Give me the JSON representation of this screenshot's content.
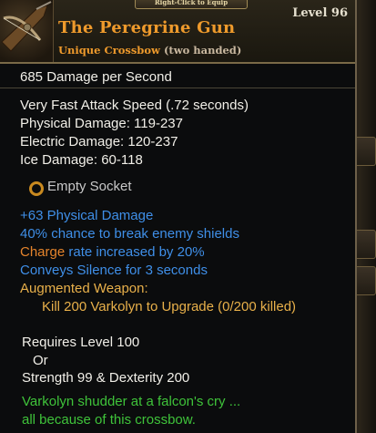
{
  "header": {
    "tab_label": "Right-Click to Equip",
    "item_name": "The Peregrine Gun",
    "item_type": "Unique Crossbow",
    "item_hands": "(two handed)",
    "level": "Level 96",
    "icon": "crossbow-icon"
  },
  "dps": {
    "value": "685",
    "label": "Damage per Second"
  },
  "base_stats": [
    "Very Fast Attack Speed (.72 seconds)",
    "Physical Damage: 119-237",
    "Electric Damage: 120-237",
    "Ice Damage: 60-118"
  ],
  "socket": {
    "label": "Empty Socket",
    "icon": "empty-socket-icon"
  },
  "affixes": {
    "physical": "+63 Physical Damage",
    "shields": "40% chance to break enemy shields",
    "charge_word": "Charge",
    "charge_rest": " rate increased by 20%",
    "silence": "Conveys Silence for 3 seconds",
    "augmented": "Augmented Weapon:",
    "upgrade": "Kill 200 Varkolyn to Upgrade (0/200 killed)"
  },
  "requirements": {
    "level": "Requires Level 100",
    "or": "Or",
    "stats": "Strength 99 & Dexterity 200"
  },
  "flavor": {
    "line1": "Varkolyn shudder at a falcon's cry ...",
    "line2": "all because of this crossbow."
  },
  "colors": {
    "item_name": "#ee9a2c",
    "magic_blue": "#3f8fe8",
    "charge_orange": "#e5842c",
    "flavor_green": "#3fc33a"
  }
}
